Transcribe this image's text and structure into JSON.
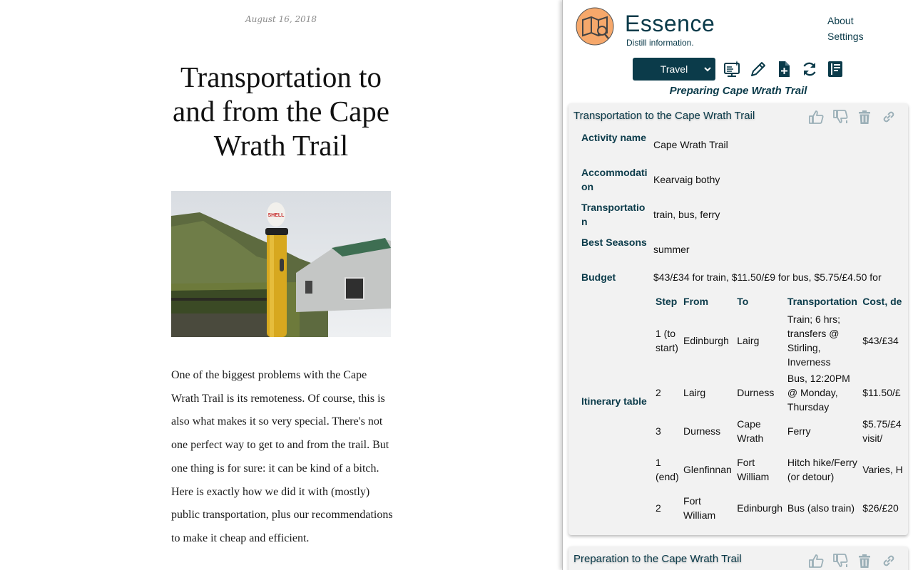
{
  "article": {
    "date": "August 16, 2018",
    "title": "Transportation to and from the Cape Wrath Trail",
    "photo_sign_text": "SHELL",
    "body": "One of the biggest problems with the Cape Wrath Trail is its remoteness. Of course, this is also what makes it so very special. There's not one perfect way to get to and from the trail. But one thing is for sure: it can be kind of a bitch. Here is exactly how we did it with (mostly) public transportation, plus our recommendations to make it cheap and efficient."
  },
  "panel": {
    "brand": "Essence",
    "tagline": "Distill information.",
    "links": {
      "about": "About",
      "settings": "Settings"
    },
    "category_select": "Travel",
    "status": "Preparing Cape Wrath Trail",
    "accent_color": "#0b3b4a",
    "logo_color": "#f6a86b",
    "tools": [
      "monitor-sparkle-icon",
      "pen-icon",
      "file-plus-icon",
      "refresh-icon",
      "journal-icon"
    ],
    "cards": [
      {
        "title": "Transportation to the Cape Wrath Trail",
        "actions": [
          "thumbs-up-icon",
          "thumbs-down-icon",
          "trash-icon",
          "link-icon"
        ],
        "fields": [
          {
            "key": "Activity name",
            "value": "Cape Wrath Trail"
          },
          {
            "key": "Accommodation",
            "value": "Kearvaig bothy"
          },
          {
            "key": "Transportation",
            "value": "train, bus, ferry"
          },
          {
            "key": "Best Seasons",
            "value": "summer"
          },
          {
            "key": "Budget",
            "value": "$43/£34 for train, $11.50/£9 for bus, $5.75/£4.50 for"
          }
        ],
        "itinerary_label": "Itinerary table",
        "itinerary_headers": [
          "Step",
          "From",
          "To",
          "Transportation",
          "Cost, de"
        ],
        "itinerary_rows": [
          [
            "1 (to start)",
            "Edinburgh",
            "Lairg",
            "Train; 6 hrs; transfers @ Stirling, Inverness",
            "$43/£34"
          ],
          [
            "2",
            "Lairg",
            "Durness",
            "Bus, 12:20PM @ Monday, Thursday",
            "$11.50/£"
          ],
          [
            "3",
            "Durness",
            "Cape Wrath",
            "Ferry",
            "$5.75/£4 visit/"
          ],
          [
            "1 (end)",
            "Glenfinnan",
            "Fort William",
            "Hitch hike/Ferry (or detour)",
            "Varies, H"
          ],
          [
            "2",
            "Fort William",
            "Edinburgh",
            "Bus (also train)",
            "$26/£20"
          ]
        ]
      },
      {
        "title": "Preparation to the Cape Wrath Trail",
        "actions": [
          "thumbs-up-icon",
          "thumbs-down-icon",
          "trash-icon",
          "link-icon"
        ]
      }
    ]
  }
}
